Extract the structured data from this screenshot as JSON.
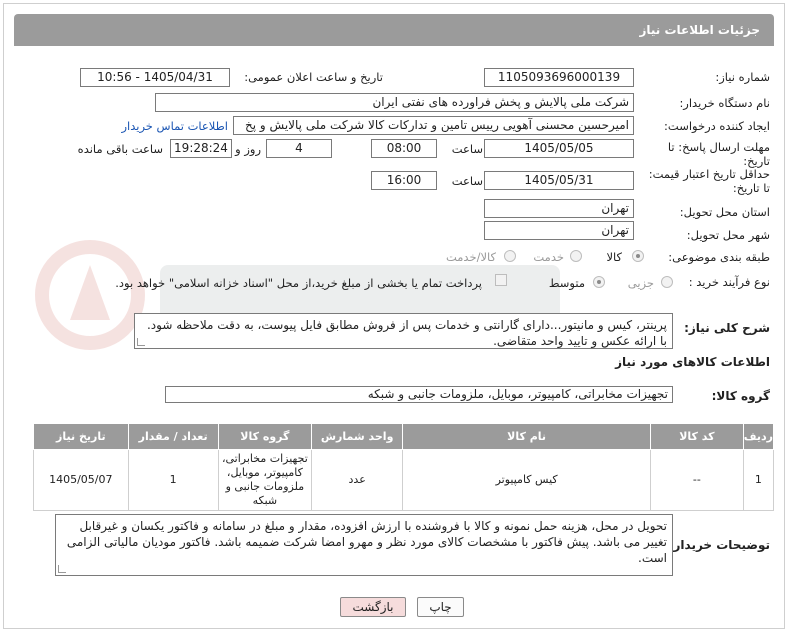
{
  "header": {
    "title": "جزئیات اطلاعات نیاز"
  },
  "fields": {
    "need_number_label": "شماره نیاز:",
    "need_number": "1105093696000139",
    "announce_label": "تاریخ و ساعت اعلان عمومی:",
    "announce_value": "1405/04/31 - 10:56",
    "buyer_label": "نام دستگاه خریدار:",
    "buyer_value": "شرکت ملی پالایش و پخش فراورده های نفتی ایران",
    "creator_label": "ایجاد کننده درخواست:",
    "creator_value": "امیرحسین محسنی آهویی رییس تامین و تدارکات کالا شرکت ملی پالایش و پخ",
    "contact_link": "اطلاعات تماس خریدار",
    "deadline_label_1": "مهلت ارسال پاسخ: تا",
    "deadline_label_2": "تاریخ:",
    "deadline_date": "1405/05/05",
    "time_label": "ساعت",
    "deadline_time": "08:00",
    "days_value": "4",
    "days_label": "روز و",
    "remaining_time": "19:28:24",
    "remaining_label": "ساعت باقی مانده",
    "validity_label_1": "حداقل تاریخ اعتبار قیمت:",
    "validity_label_2": "تا تاریخ:",
    "validity_date": "1405/05/31",
    "validity_time": "16:00",
    "province_label": "استان محل تحویل:",
    "province_value": "تهران",
    "city_label": "شهر محل تحویل:",
    "city_value": "تهران",
    "category_label": "طبقه بندی موضوعی:",
    "category_options": [
      "کالا",
      "خدمت",
      "کالا/خدمت"
    ],
    "process_label": "نوع فرآیند خرید :",
    "process_options": [
      "جزیی",
      "متوسط"
    ],
    "payment_text": "پرداخت تمام یا بخشی از مبلغ خرید،از محل \"اسناد خزانه اسلامی\" خواهد بود."
  },
  "description": {
    "label": "شرح کلی نیاز:",
    "value": "پرینتر، کیس و مانیتور...دارای گارانتی و خدمات پس از فروش مطابق فایل پیوست، به دقت ملاحظه شود. با ارائه عکس و تایید واحد متقاضی."
  },
  "goods_info_title": "اطلاعات کالاهای مورد نیاز",
  "goods_group": {
    "label": "گروه کالا:",
    "value": "تجهیزات مخابراتی، کامپیوتر، موبایل، ملزومات جانبی و شبکه"
  },
  "table": {
    "headers": [
      "ردیف",
      "کد کالا",
      "نام کالا",
      "واحد شمارش",
      "گروه کالا",
      "تعداد / مقدار",
      "تاریخ نیاز"
    ],
    "rows": [
      [
        "1",
        "--",
        "کیس کامپیوتر",
        "عدد",
        "تجهیزات مخابراتی، کامپیوتر، موبایل، ملزومات جانبی و شبکه",
        "1",
        "1405/05/07"
      ]
    ]
  },
  "buyer_notes": {
    "label": "توضیحات خریدار:",
    "value": "تحویل در محل، هزینه حمل نمونه و کالا با فروشنده با ارزش افزوده، مقدار و مبلغ در سامانه و فاکتور یکسان و غیرقابل تغییر می باشد. پیش فاکتور با مشخصات کالای مورد نظر و مهرو امضا شرکت ضمیمه باشد. فاکتور مودیان مالیاتی الزامی است."
  },
  "buttons": {
    "print": "چاپ",
    "back": "بازگشت"
  },
  "colors": {
    "header_bg": "#9b9b9b",
    "link": "#1a55b3",
    "back_btn_bg": "#f6dcdc"
  }
}
